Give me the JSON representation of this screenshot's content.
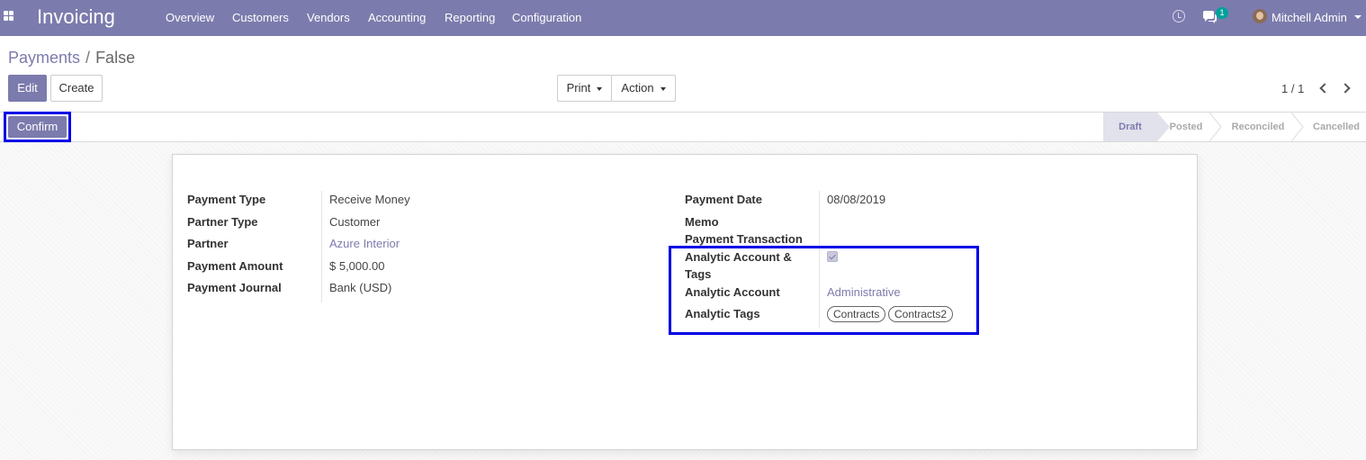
{
  "navbar": {
    "app_title": "Invoicing",
    "menu": [
      "Overview",
      "Customers",
      "Vendors",
      "Accounting",
      "Reporting",
      "Configuration"
    ],
    "chat_count": "1",
    "user_name": "Mitchell Admin",
    "bg_color": "#7c7bad"
  },
  "breadcrumb": {
    "parent": "Payments",
    "separator": "/",
    "current": "False"
  },
  "buttons": {
    "edit": "Edit",
    "create": "Create",
    "print": "Print",
    "action": "Action",
    "confirm": "Confirm"
  },
  "pager": "1 / 1",
  "stages": [
    "Draft",
    "Posted",
    "Reconciled",
    "Cancelled"
  ],
  "active_stage": "Draft",
  "form": {
    "left": [
      {
        "label": "Payment Type",
        "value": "Receive Money"
      },
      {
        "label": "Partner Type",
        "value": "Customer"
      },
      {
        "label": "Partner",
        "value": "Azure Interior"
      },
      {
        "label": "Payment Amount",
        "value": "$ 5,000.00"
      },
      {
        "label": "Payment Journal",
        "value": "Bank (USD)"
      }
    ],
    "right": {
      "payment_date_label": "Payment Date",
      "payment_date": "08/08/2019",
      "memo_label": "Memo",
      "payment_transaction_label": "Payment Transaction",
      "analytic_account_tags_label_1": "Analytic Account &",
      "analytic_account_tags_label_2": "Tags",
      "analytic_account_tags_checked": true,
      "analytic_account_label": "Analytic Account",
      "analytic_account": "Administrative",
      "analytic_tags_label": "Analytic Tags",
      "analytic_tags": [
        "Contracts",
        "Contracts2"
      ]
    }
  },
  "colors": {
    "accent": "#7c7bad",
    "highlight_box": "#0000e6"
  }
}
